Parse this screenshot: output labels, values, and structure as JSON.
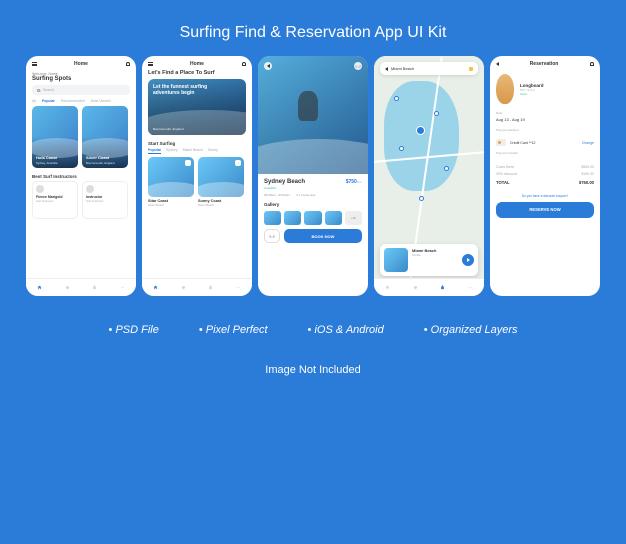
{
  "banner": {
    "title": "Surfing Find & Reservation App UI Kit"
  },
  "features": [
    "PSD File",
    "Pixel Perfect",
    "iOS & Android",
    "Organized Layers"
  ],
  "footer_note": "Image Not Included",
  "screen1": {
    "header_title": "Home",
    "greeting": "Welcome, Name",
    "heading": "Surfing Spots",
    "search_placeholder": "Search",
    "tabs": [
      "All",
      "Popular",
      "Recommended",
      "Most Viewed"
    ],
    "active_tab": "Popular",
    "spots": [
      {
        "name": "Hola Coast",
        "location": "Sydney, Australia"
      },
      {
        "name": "Silver Coast",
        "location": "Bournemouth, England"
      }
    ],
    "instructors_h": "Best Surf Instructors",
    "instructors": [
      {
        "name": "Fleece Marigold",
        "role": "Surf Instructor"
      },
      {
        "name": "Instructor",
        "role": "Surf Instructor"
      }
    ]
  },
  "screen2": {
    "header_title": "Home",
    "hero_heading": "Let's Find a Place To Surf",
    "hero_title": "Let the funnest surfing adventures begin",
    "hero_loc": "Bournemouth, England",
    "section_h": "Start Surfing",
    "tabs": [
      "Popular",
      "Sydney",
      "Miami Beach",
      "Sunny"
    ],
    "active_tab": "Popular",
    "cards": [
      {
        "name": "Sitar Coast",
        "loc": "Miami Beach"
      },
      {
        "name": "Sunny Coast",
        "loc": "Miami Beach"
      }
    ]
  },
  "screen3": {
    "title": "Sydney Beach",
    "availability": "Available",
    "price": "$750",
    "price_unit": "/d-n",
    "meta_time": "08:00am - 04:00pm",
    "meta_rating": "4.7 review-ties",
    "gallery_h": "Gallery",
    "gallery_more": "+10",
    "book_label": "BOOK NOW"
  },
  "screen4": {
    "search_placeholder": "Miami Beach",
    "card": {
      "name": "Miami Beach",
      "loc": "Florida"
    }
  },
  "screen5": {
    "header_title": "Reservation",
    "product": {
      "name": "Longboard",
      "dim": "9'0\" / 2.4 m",
      "status": "Open"
    },
    "date_label": "Date",
    "date_val": "Aug 13 - Aug 19",
    "pay_method_label": "Payment Method",
    "pay_method_val": "Credit Card  **12",
    "pay_change": "Change",
    "summary_label": "Payment Details",
    "rows": [
      {
        "label": "Costs there",
        "val": "$950.00"
      },
      {
        "label": "20% discount",
        "val": "$190.00"
      }
    ],
    "total_label": "TOTAL",
    "total_val": "$760.00",
    "coupon": "Do you have a discount coupon?",
    "reserve_label": "RESERVE NOW"
  }
}
